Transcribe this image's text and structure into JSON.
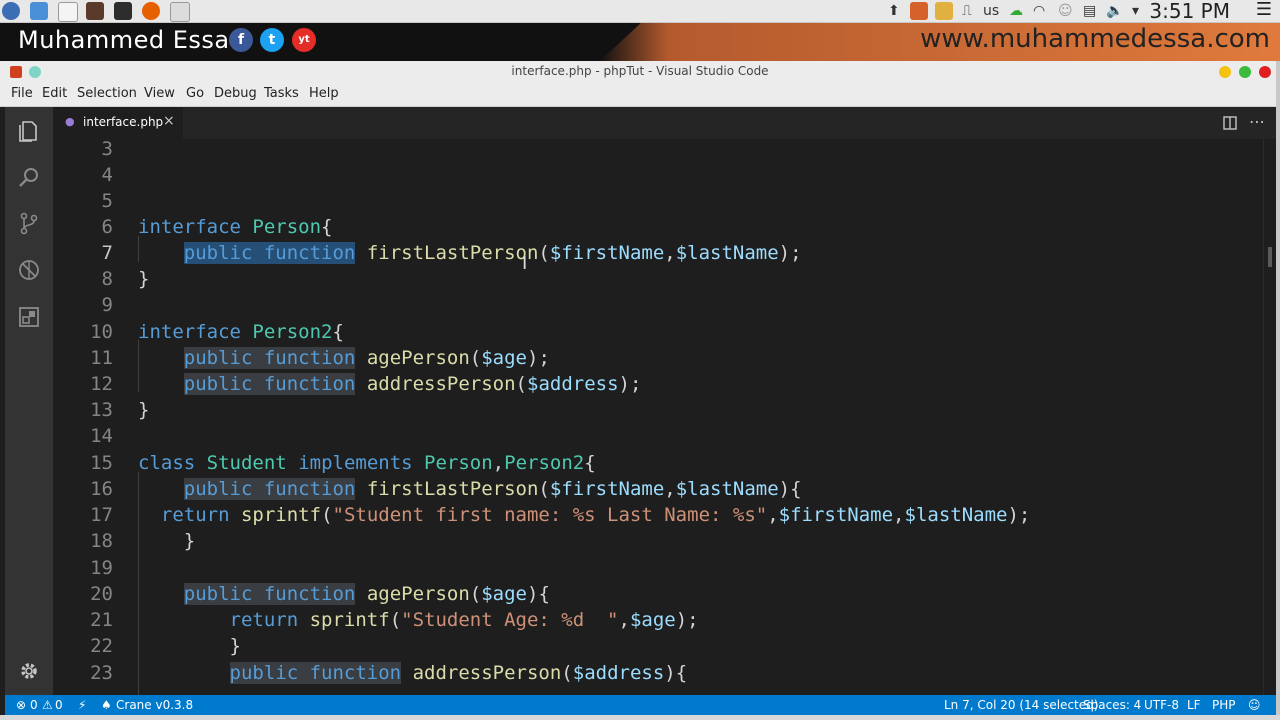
{
  "os": {
    "clock": "3:51 PM",
    "keyboard": "us"
  },
  "banner": {
    "name": "Muhammed Essa",
    "url": "www.muhammedessa.com",
    "social": [
      "f",
      "t",
      "yt"
    ]
  },
  "window": {
    "title": "interface.php - phpTut - Visual Studio Code"
  },
  "menu": [
    "File",
    "Edit",
    "Selection",
    "View",
    "Go",
    "Debug",
    "Tasks",
    "Help"
  ],
  "tab": {
    "label": "interface.php",
    "close": "×"
  },
  "editor": {
    "lines": [
      {
        "n": "3",
        "code": ""
      },
      {
        "n": "4",
        "code": ""
      },
      {
        "n": "5",
        "code": ""
      },
      {
        "n": "6",
        "code": "interface Person{"
      },
      {
        "n": "7",
        "code": "    public function firstLastPerson($firstName,$lastName);"
      },
      {
        "n": "8",
        "code": "}"
      },
      {
        "n": "9",
        "code": ""
      },
      {
        "n": "10",
        "code": "interface Person2{"
      },
      {
        "n": "11",
        "code": "    public function agePerson($age);"
      },
      {
        "n": "12",
        "code": "    public function addressPerson($address);"
      },
      {
        "n": "13",
        "code": "}"
      },
      {
        "n": "14",
        "code": ""
      },
      {
        "n": "15",
        "code": "class Student implements Person,Person2{"
      },
      {
        "n": "16",
        "code": "    public function firstLastPerson($firstName,$lastName){"
      },
      {
        "n": "17",
        "code": "  return sprintf(\"Student first name: %s Last Name: %s\",$firstName,$lastName);"
      },
      {
        "n": "18",
        "code": "    }"
      },
      {
        "n": "19",
        "code": ""
      },
      {
        "n": "20",
        "code": "    public function agePerson($age){"
      },
      {
        "n": "21",
        "code": "        return sprintf(\"Student Age: %d  \",$age);"
      },
      {
        "n": "22",
        "code": "        }"
      },
      {
        "n": "23",
        "code": "        public function addressPerson($address){"
      }
    ]
  },
  "status": {
    "errors": "0",
    "warnings": "0",
    "extension": "Crane v0.3.8",
    "position": "Ln 7, Col 20 (14 selected)",
    "spaces": "Spaces: 4",
    "encoding": "UTF-8",
    "eol": "LF",
    "language": "PHP"
  },
  "colors": {
    "accent": "#007acc",
    "keyword": "#569cd6",
    "type": "#4ec9b0",
    "function": "#dcdcaa",
    "variable": "#9cdcfe",
    "string": "#ce9178"
  }
}
